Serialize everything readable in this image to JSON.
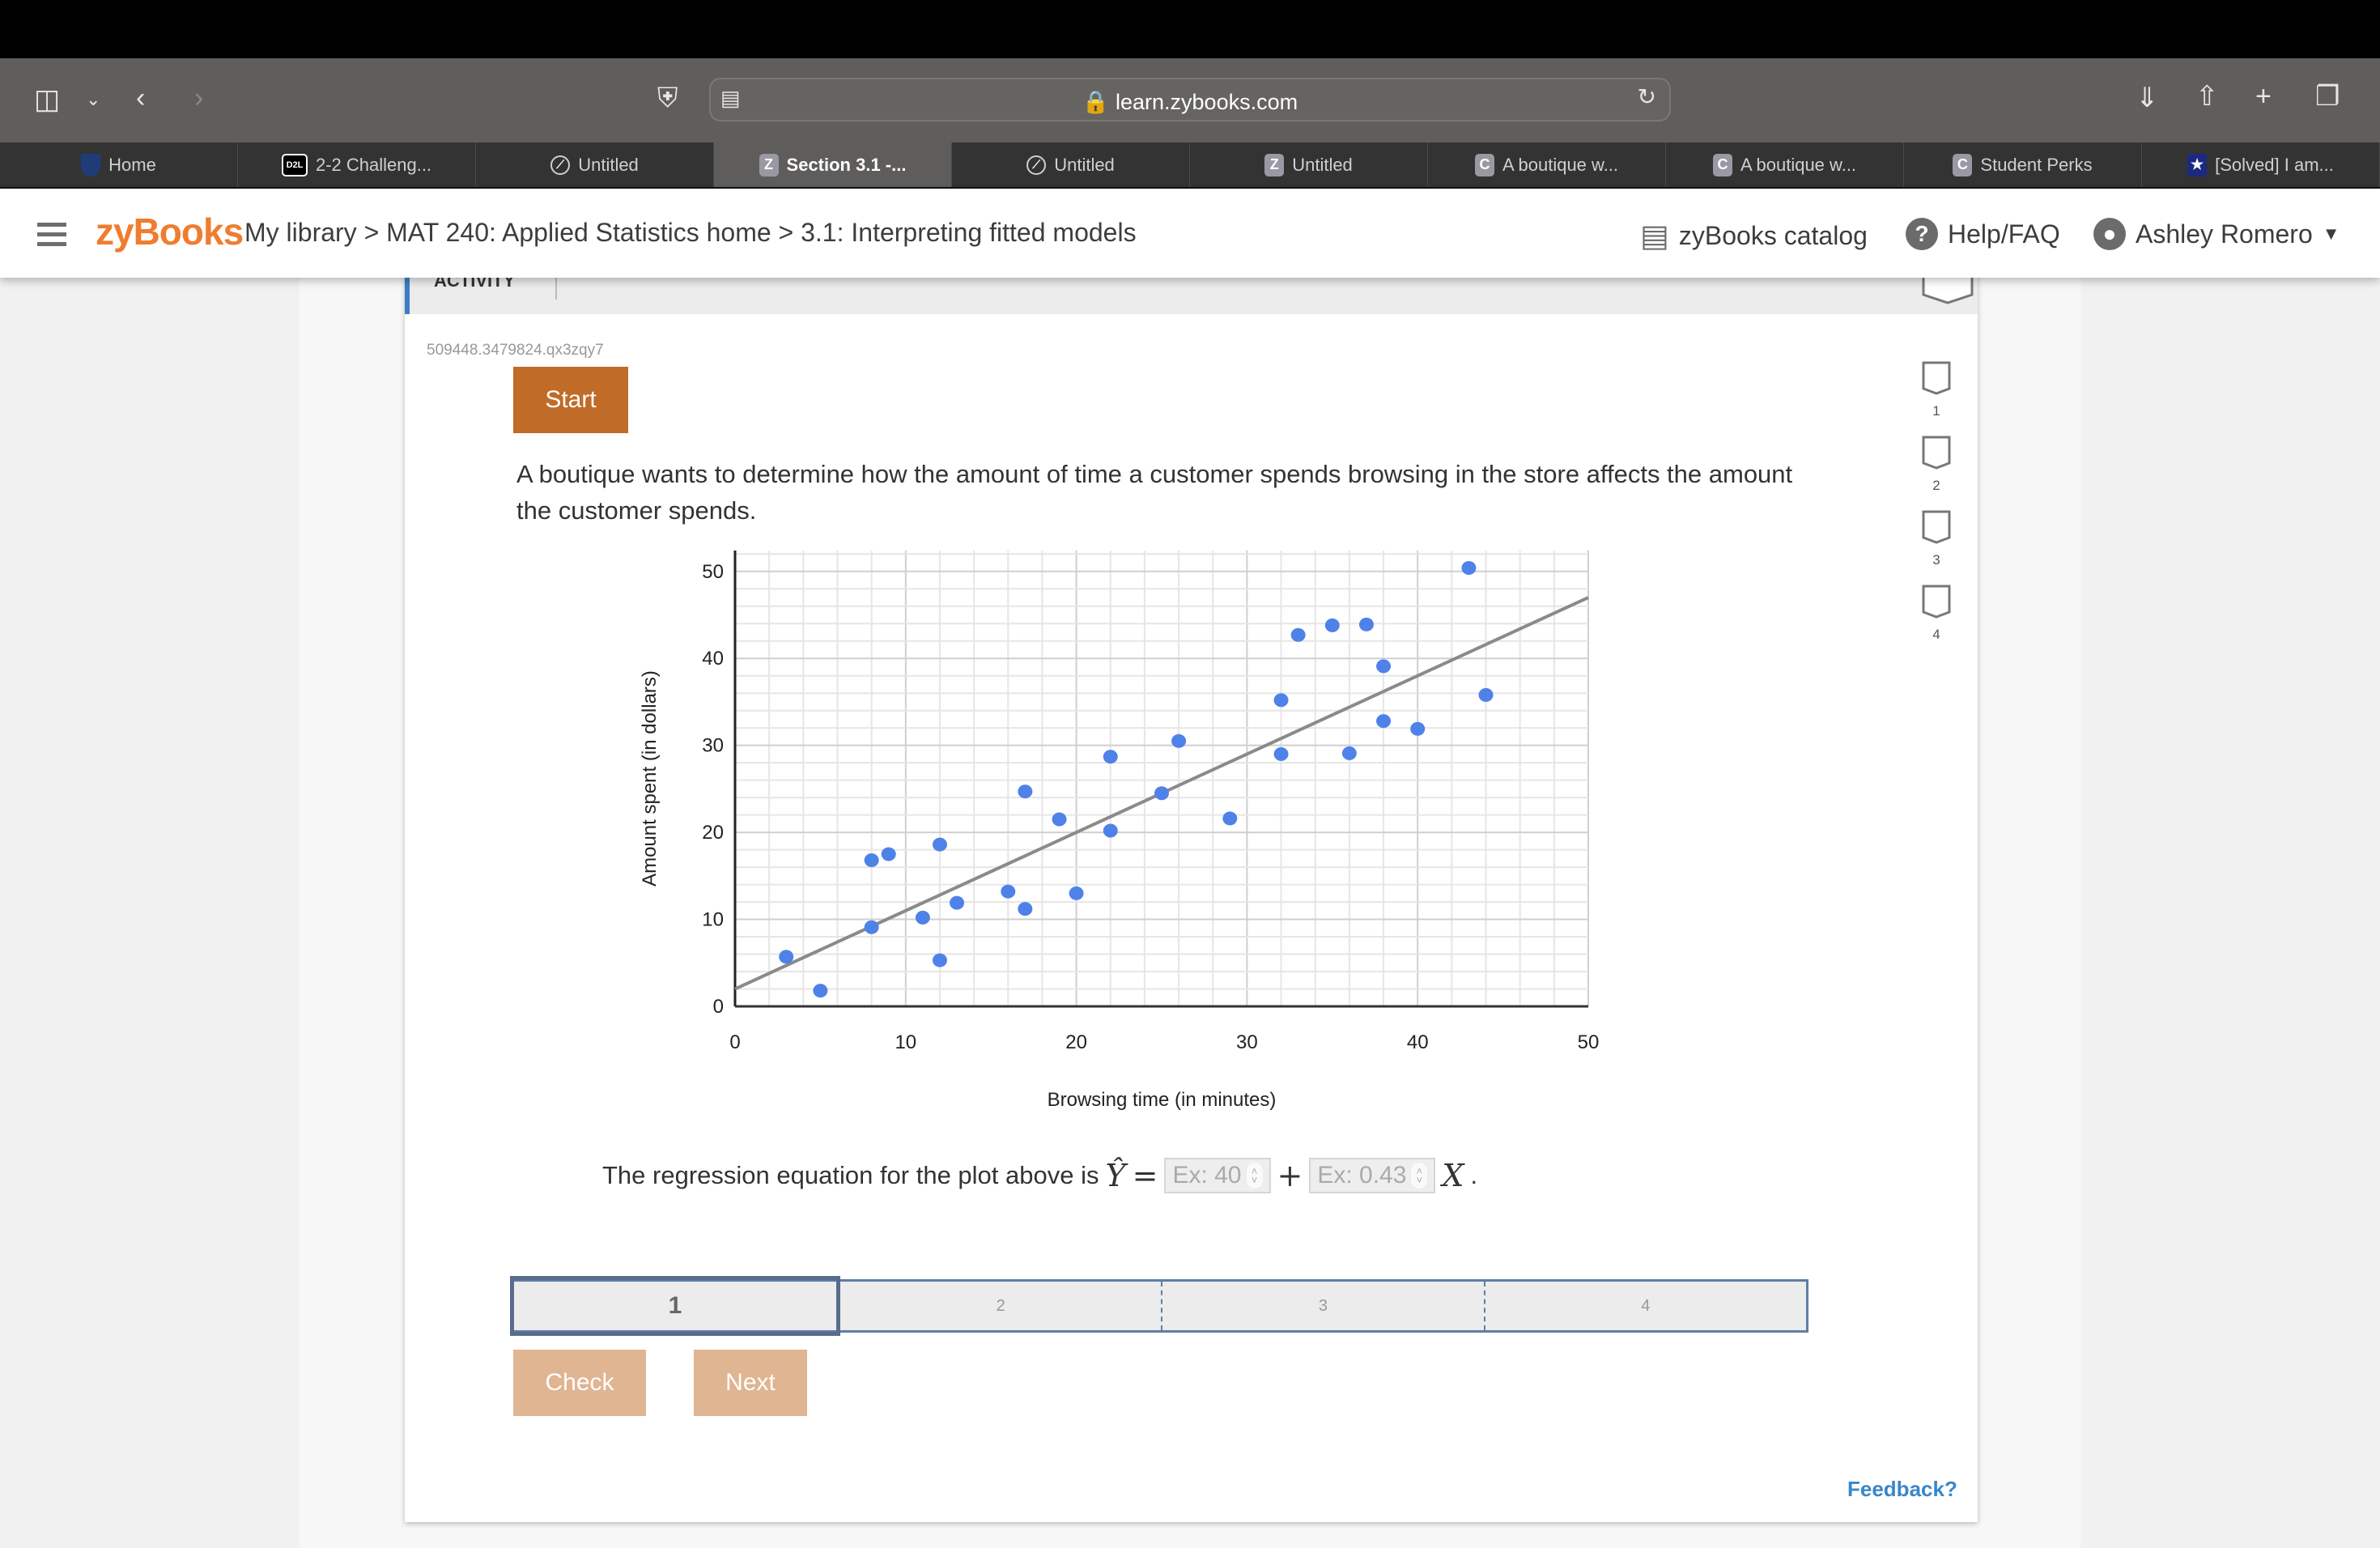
{
  "browser": {
    "url": "learn.zybooks.com",
    "tabs": [
      {
        "label": "Home",
        "icon": "shield"
      },
      {
        "label": "2-2 Challeng...",
        "icon": "d2l"
      },
      {
        "label": "Untitled",
        "icon": "compass"
      },
      {
        "label": "Section 3.1 -...",
        "icon": "Z",
        "active": true
      },
      {
        "label": "Untitled",
        "icon": "compass"
      },
      {
        "label": "Untitled",
        "icon": "Z"
      },
      {
        "label": "A boutique w...",
        "icon": "C"
      },
      {
        "label": "A boutique w...",
        "icon": "C"
      },
      {
        "label": "Student Perks",
        "icon": "C"
      },
      {
        "label": "[Solved] I am...",
        "icon": "star"
      }
    ]
  },
  "header": {
    "logo": "zyBooks",
    "breadcrumb": "My library > MAT 240: Applied Statistics home > 3.1: Interpreting fitted models",
    "catalog": "zyBooks catalog",
    "help": "Help/FAQ",
    "user": "Ashley Romero"
  },
  "activity": {
    "label": "ACTIVITY",
    "question_id": "509448.3479824.qx3zqy7",
    "start_label": "Start",
    "prompt": "A boutique wants to determine how the amount of time a customer spends browsing in the store affects the amount the customer spends.",
    "levels": [
      "1",
      "2",
      "3",
      "4"
    ],
    "equation": {
      "lead": "The regression equation for the plot above is",
      "intercept_placeholder": "Ex: 40",
      "slope_placeholder": "Ex: 0.43"
    },
    "progress": [
      "1",
      "2",
      "3",
      "4"
    ],
    "check_label": "Check",
    "next_label": "Next",
    "feedback_label": "Feedback?"
  },
  "chart_data": {
    "type": "scatter",
    "title": "",
    "xlabel": "Browsing time (in minutes)",
    "ylabel": "Amount spent (in dollars)",
    "xlim": [
      0,
      50
    ],
    "ylim": [
      0,
      52
    ],
    "xticks": [
      0,
      10,
      20,
      30,
      40,
      50
    ],
    "yticks": [
      0,
      10,
      20,
      30,
      40,
      50
    ],
    "grid": true,
    "point_color": "#4f82e8",
    "line_color": "#8a8a8a",
    "points": [
      [
        3,
        5.7
      ],
      [
        5,
        1.8
      ],
      [
        8,
        9.1
      ],
      [
        8,
        16.8
      ],
      [
        9,
        17.5
      ],
      [
        11,
        10.2
      ],
      [
        12,
        18.6
      ],
      [
        12,
        5.3
      ],
      [
        13,
        11.9
      ],
      [
        16,
        13.2
      ],
      [
        17,
        11.2
      ],
      [
        17,
        24.7
      ],
      [
        19,
        21.5
      ],
      [
        20,
        13.0
      ],
      [
        22,
        20.2
      ],
      [
        22,
        28.7
      ],
      [
        25,
        24.5
      ],
      [
        26,
        30.5
      ],
      [
        29,
        21.6
      ],
      [
        32,
        35.2
      ],
      [
        32,
        29.0
      ],
      [
        33,
        42.7
      ],
      [
        35,
        43.8
      ],
      [
        36,
        29.1
      ],
      [
        37,
        43.9
      ],
      [
        38,
        39.1
      ],
      [
        38,
        32.8
      ],
      [
        40,
        31.9
      ],
      [
        43,
        50.4
      ],
      [
        44,
        35.8
      ]
    ],
    "regression_line": {
      "intercept": 2.0,
      "slope": 0.9
    }
  }
}
